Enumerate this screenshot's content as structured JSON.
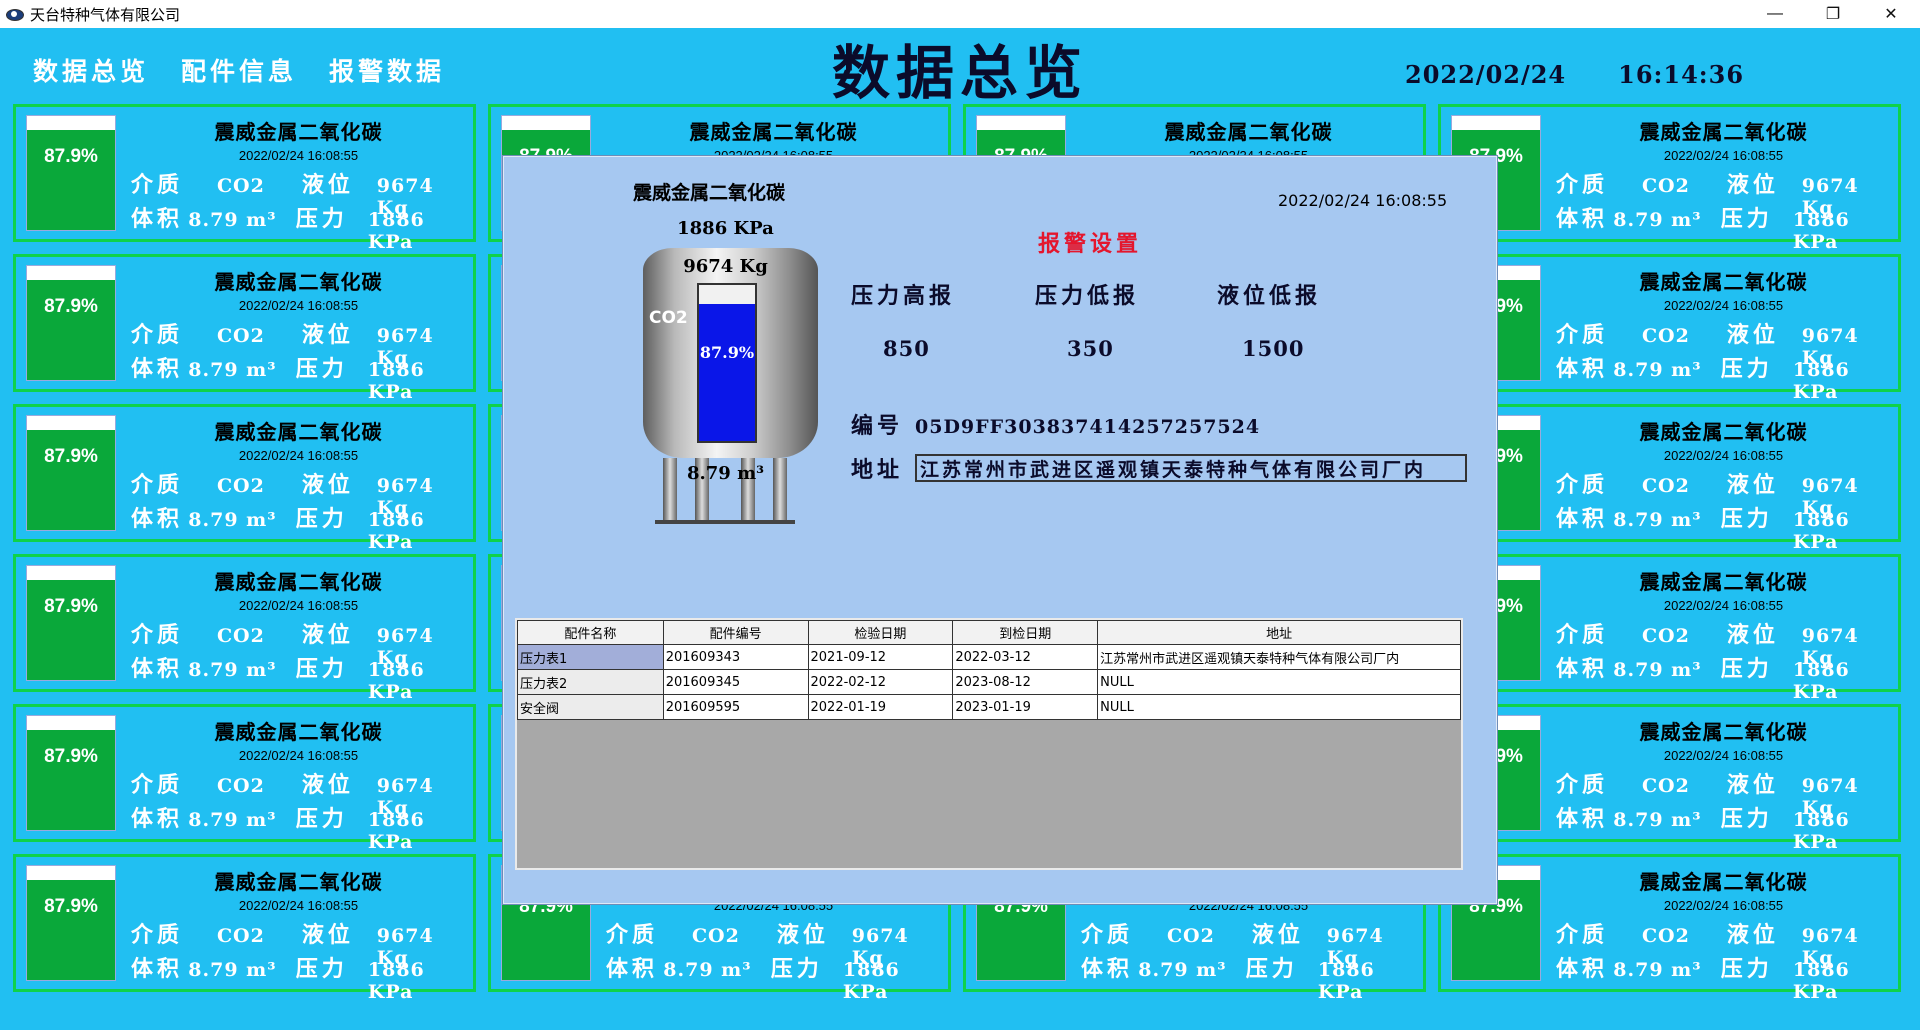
{
  "window": {
    "title": "天台特种气体有限公司",
    "icon": "app-logo-icon",
    "min_label": "—",
    "restore_label": "❐",
    "close_label": "✕"
  },
  "nav": {
    "items": [
      "数据总览",
      "配件信息",
      "报警数据"
    ]
  },
  "header": {
    "title": "数据总览",
    "date": "2022/02/24",
    "time": "16:14:36"
  },
  "colors": {
    "background": "#21bff2",
    "card_border": "#0fd24a",
    "gauge_fill": "#0aa83a",
    "dialog_bg": "#a6c8f1",
    "alarm_title": "#e4162d",
    "liquid": "#0a16e8"
  },
  "card": {
    "name": "震威金属二氧化碳",
    "timestamp": "2022/02/24 16:08:55",
    "level_pct": 0.879,
    "level_text": "87.9%",
    "medium_label": "介质",
    "medium": "CO2",
    "level_label": "液位",
    "level_value": "9674 Kg",
    "volume_label": "体积",
    "volume": "8.79 m³",
    "pressure_label": "压力",
    "pressure": "1886 KPa"
  },
  "dialog": {
    "name": "震威金属二氧化碳",
    "timestamp": "2022/02/24 16:08:55",
    "tank": {
      "pressure": "1886 KPa",
      "level": "9674 Kg",
      "medium": "CO2",
      "level_pct": 0.879,
      "level_text": "87.9%",
      "volume": "8.79 m³"
    },
    "alarm": {
      "title": "报警设置",
      "labels": [
        "压力高报",
        "压力低报",
        "液位低报"
      ],
      "values": [
        "850",
        "350",
        "1500"
      ]
    },
    "id_label": "编号",
    "id_value": "05D9FF303837414257257524",
    "address_label": "地址",
    "address_value": "江苏常州市武进区遥观镇天泰特种气体有限公司厂内",
    "table": {
      "columns": [
        "配件名称",
        "配件编号",
        "检验日期",
        "到检日期",
        "地址"
      ],
      "rows": [
        [
          "压力表1",
          "201609343",
          "2021-09-12",
          "2022-03-12",
          "江苏常州市武进区遥观镇天泰特种气体有限公司厂内"
        ],
        [
          "压力表2",
          "201609345",
          "2022-02-12",
          "2023-08-12",
          "NULL"
        ],
        [
          "安全阀",
          "201609595",
          "2022-01-19",
          "2023-01-19",
          "NULL"
        ]
      ]
    }
  }
}
